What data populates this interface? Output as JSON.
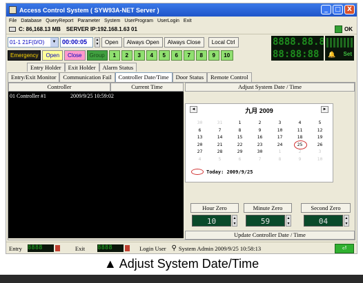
{
  "window": {
    "title": "Access Control System ( SYW93A-NET Server )",
    "controls": [
      "_",
      "□",
      "X"
    ]
  },
  "menu": [
    "File",
    "Database",
    "QueryReport",
    "Parameter",
    "System",
    "UserProgram",
    "UserLogin",
    "Exit"
  ],
  "statusline": {
    "disk": "C: 86,168.13 MB",
    "server": "SERVER IP:192.168.1.63  01",
    "ok_label": "OK"
  },
  "toolbar": {
    "controller_select": "01-1 21F(0/O)",
    "time_value": "00:00:05",
    "buttons": [
      "Open",
      "Always Open",
      "Always Close",
      "Local Ctrl"
    ]
  },
  "door_buttons": {
    "emergency": "Emergency",
    "open": "Open",
    "close": "Close",
    "group": "Group",
    "numbers": [
      "1",
      "2",
      "3",
      "4",
      "5",
      "6",
      "7",
      "8",
      "9",
      "10"
    ]
  },
  "led": {
    "date": "8888.88.88",
    "time": "88:88:88",
    "set_label": "Set",
    "bell_icon": "bell-icon"
  },
  "tabs_row1": [
    "Entry Holder",
    "Exit Holder",
    "Alarm Status"
  ],
  "tabs_row2": [
    "Entry/Exit Monitor",
    "Communication Fail",
    "Controller Date/Time",
    "Door Status",
    "Remote Control"
  ],
  "active_tab": "Controller Date/Time",
  "left_table": {
    "headers": [
      "Controller",
      "Current Time"
    ],
    "rows": [
      {
        "controller": "01 Controller #1",
        "time": "2009/9/25  10:59:02"
      }
    ]
  },
  "right_panel": {
    "header": "Adjust System Date / Time",
    "calendar": {
      "month_title": "九月 2009",
      "prev": "◄",
      "next": "►",
      "weeks": [
        [
          {
            "d": "30",
            "dim": true
          },
          {
            "d": "31",
            "dim": true
          },
          {
            "d": "1"
          },
          {
            "d": "2"
          },
          {
            "d": "3"
          },
          {
            "d": "4"
          },
          {
            "d": "5"
          }
        ],
        [
          {
            "d": "6"
          },
          {
            "d": "7"
          },
          {
            "d": "8"
          },
          {
            "d": "9"
          },
          {
            "d": "10"
          },
          {
            "d": "11"
          },
          {
            "d": "12"
          }
        ],
        [
          {
            "d": "13"
          },
          {
            "d": "14"
          },
          {
            "d": "15"
          },
          {
            "d": "16"
          },
          {
            "d": "17"
          },
          {
            "d": "18"
          },
          {
            "d": "19"
          }
        ],
        [
          {
            "d": "20"
          },
          {
            "d": "21"
          },
          {
            "d": "22"
          },
          {
            "d": "23"
          },
          {
            "d": "24"
          },
          {
            "d": "25",
            "circle": true
          },
          {
            "d": "26"
          }
        ],
        [
          {
            "d": "27"
          },
          {
            "d": "28"
          },
          {
            "d": "29"
          },
          {
            "d": "30"
          },
          {
            "d": "1",
            "dim": true
          },
          {
            "d": "2",
            "dim": true
          },
          {
            "d": "3",
            "dim": true
          }
        ],
        [
          {
            "d": "4",
            "dim": true
          },
          {
            "d": "5",
            "dim": true
          },
          {
            "d": "6",
            "dim": true
          },
          {
            "d": "7",
            "dim": true
          },
          {
            "d": "8",
            "dim": true
          },
          {
            "d": "9",
            "dim": true
          },
          {
            "d": "10",
            "dim": true
          }
        ]
      ],
      "today": "Today: 2009/9/25"
    },
    "zero_buttons": [
      "Hour Zero",
      "Minute Zero",
      "Second Zero"
    ],
    "zero_values": [
      "10",
      "59",
      "04"
    ],
    "update_button": "Update Controller Date / Time"
  },
  "bottombar": {
    "entry_label": "Entry",
    "entry_led": "8888",
    "exit_label": "Exit",
    "exit_led": "8888",
    "login_label": "Login User",
    "login_value": "System Admin  2009/9/25  10:58:13"
  },
  "caption": "Adjust System Date/Time"
}
